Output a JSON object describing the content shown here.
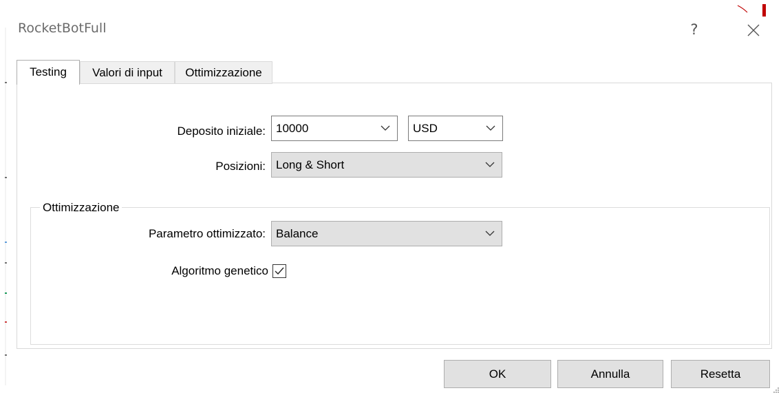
{
  "window": {
    "title": "RocketBotFull",
    "help_label": "?"
  },
  "tabs": [
    {
      "label": "Testing",
      "active": true
    },
    {
      "label": "Valori di input",
      "active": false
    },
    {
      "label": "Ottimizzazione",
      "active": false
    }
  ],
  "testing": {
    "deposit_label": "Deposito iniziale:",
    "deposit_value": "10000",
    "currency_value": "USD",
    "positions_label": "Posizioni:",
    "positions_value": "Long & Short"
  },
  "optimization_group": {
    "legend": "Ottimizzazione",
    "param_label": "Parametro ottimizzato:",
    "param_value": "Balance",
    "genetic_label": "Algoritmo genetico",
    "genetic_checked": true
  },
  "buttons": {
    "ok": "OK",
    "cancel": "Annulla",
    "reset": "Resetta"
  },
  "icons": {
    "help": "question-mark-icon",
    "close": "close-icon",
    "dropdown": "chevron-down-icon",
    "check": "checkmark-icon",
    "grip": "resize-grip-icon"
  },
  "colors": {
    "dropdown_bg": "#e1e1e1",
    "button_bg": "#e1e1e1",
    "title_text": "#6b6b6b"
  }
}
